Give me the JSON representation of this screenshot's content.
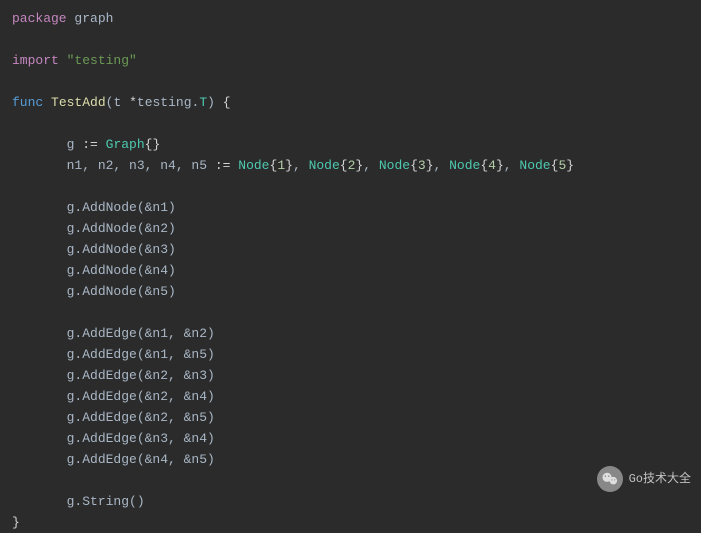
{
  "code": {
    "package_keyword": "package",
    "package_name": "graph",
    "import_keyword": "import",
    "import_path": "\"testing\"",
    "func_keyword": "func",
    "func_name": "TestAdd",
    "param_name": "t",
    "param_type_star": "*",
    "param_type_pkg": "testing",
    "param_type_name": "T",
    "graph_decl_var": "g",
    "graph_decl_type": "Graph",
    "node_decl_vars": "n1, n2, n3, n4, n5",
    "node_decl_type": "Node",
    "node_values": [
      "1",
      "2",
      "3",
      "4",
      "5"
    ],
    "add_node_calls": [
      "g.AddNode(&n1)",
      "g.AddNode(&n2)",
      "g.AddNode(&n3)",
      "g.AddNode(&n4)",
      "g.AddNode(&n5)"
    ],
    "add_edge_calls": [
      "g.AddEdge(&n1, &n2)",
      "g.AddEdge(&n1, &n5)",
      "g.AddEdge(&n2, &n3)",
      "g.AddEdge(&n2, &n4)",
      "g.AddEdge(&n2, &n5)",
      "g.AddEdge(&n3, &n4)",
      "g.AddEdge(&n4, &n5)"
    ],
    "string_call": "g.String()"
  },
  "watermark": {
    "text": "Go技术大全"
  }
}
